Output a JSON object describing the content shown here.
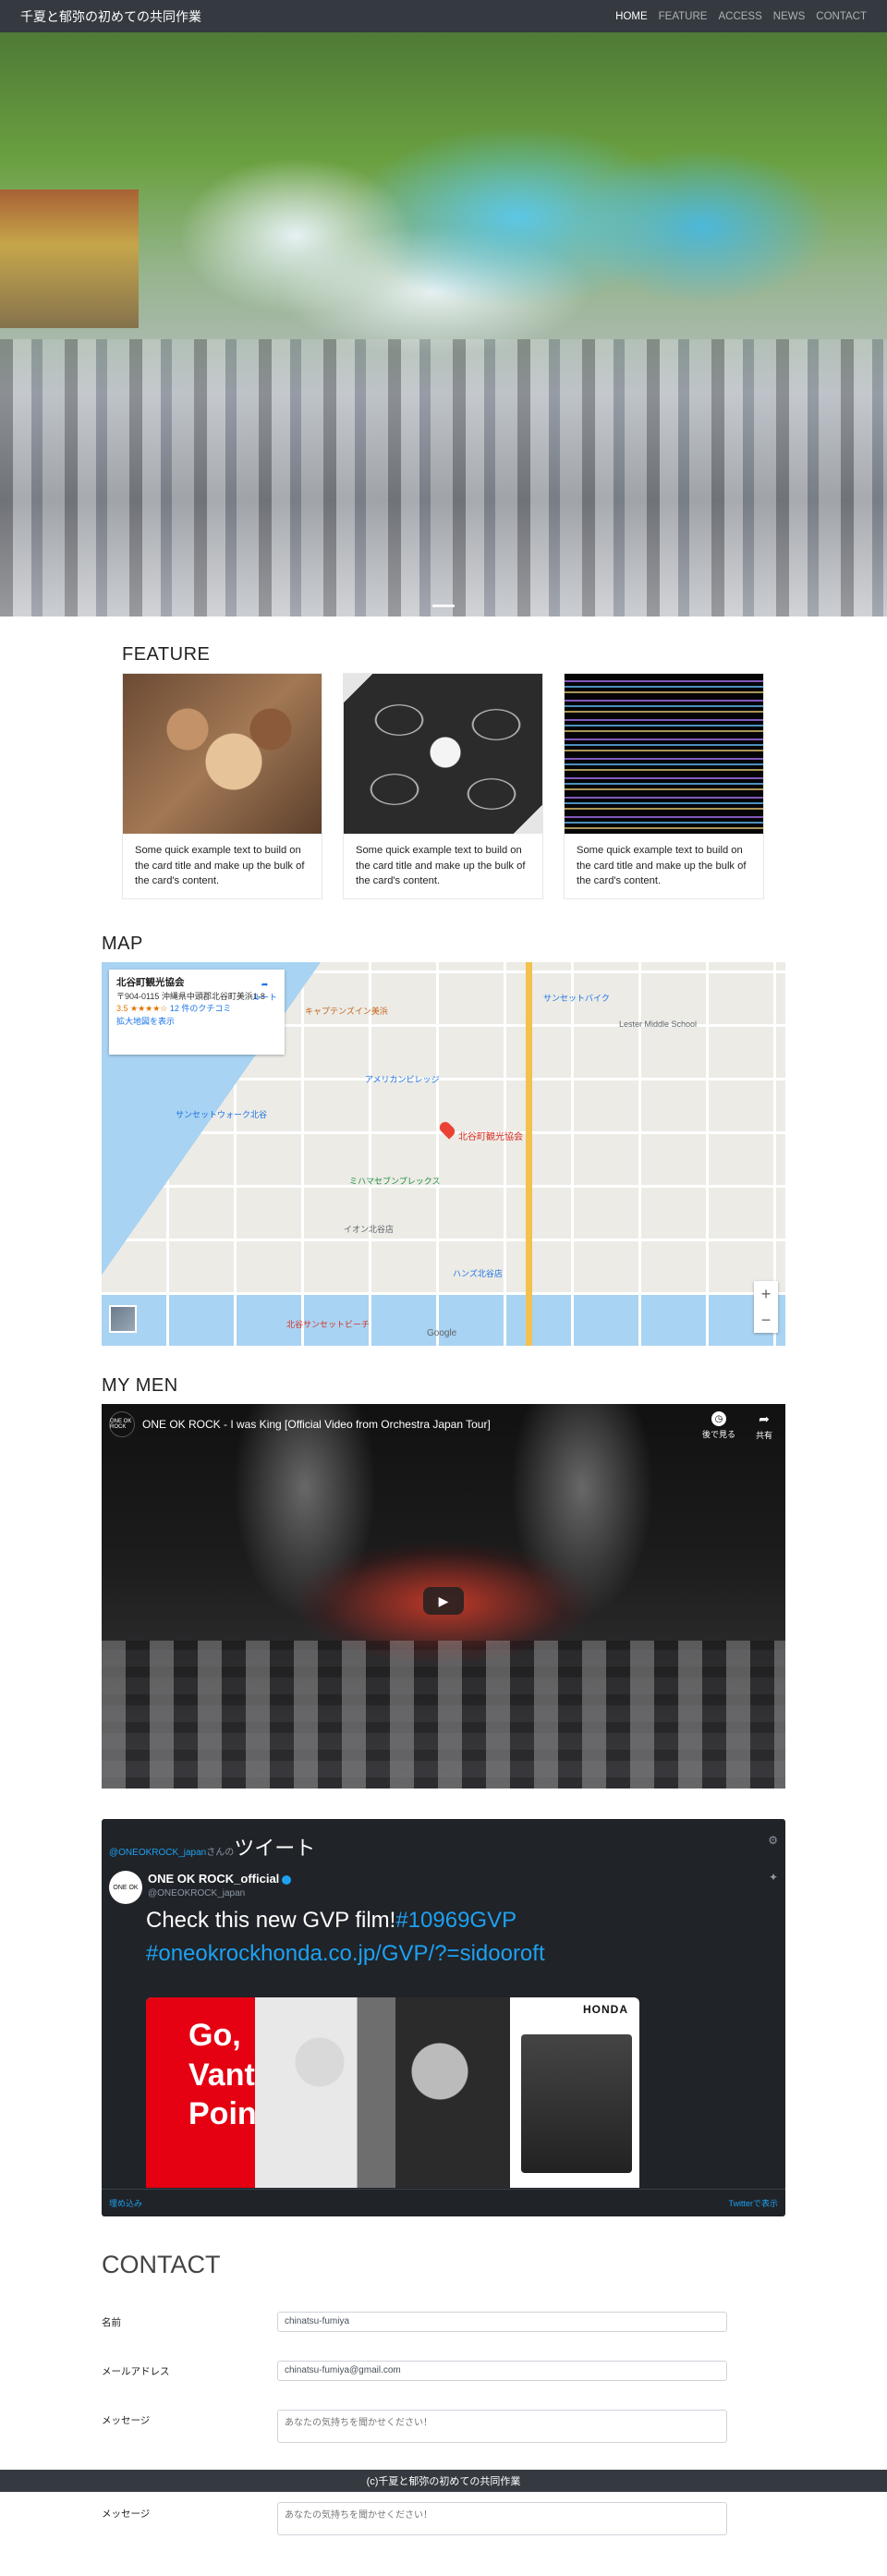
{
  "navbar": {
    "brand": "千夏と郁弥の初めての共同作業",
    "links": [
      "HOME",
      "FEATURE",
      "ACCESS",
      "NEWS",
      "CONTACT"
    ],
    "active_index": 0
  },
  "feature": {
    "heading": "FEATURE",
    "cards": [
      {
        "text": "Some quick example text to build on the card title and make up the bulk of the card's content."
      },
      {
        "text": "Some quick example text to build on the card title and make up the bulk of the card's content."
      },
      {
        "text": "Some quick example text to build on the card title and make up the bulk of the card's content."
      }
    ]
  },
  "map": {
    "heading": "MAP",
    "place_name": "北谷町観光協会",
    "address": "〒904-0115 沖縄県中頭郡北谷町美浜1-8",
    "rating": "3.5 ★★★★☆",
    "reviews": "12 件のクチコミ",
    "larger_map_link": "拡大地図を表示",
    "directions": "ルート",
    "pin_label": "北谷町観光協会",
    "labels": [
      "サンセットバイク",
      "キャプテンズイン美浜",
      "アメリカンビレッジ",
      "サンセットウォーク北谷",
      "ミハマセブンプレックス",
      "イオン北谷店",
      "北谷サンセットビーチ",
      "ハンズ北谷店",
      "Lester Middle School"
    ],
    "google": "Google",
    "zoom_in": "+",
    "zoom_out": "−"
  },
  "men": {
    "heading": "MY MEN",
    "channel": "ONE OK ROCK",
    "video_title": "ONE OK ROCK - I was King [Official Video from Orchestra Japan Tour]",
    "watch_later": "後で見る",
    "share": "共有"
  },
  "twitter": {
    "header_user": "@ONEOKROCK_japan",
    "header_suffix": "さんの",
    "header_big": "ツイート",
    "name": "ONE OK ROCK_official",
    "handle": "@ONEOKROCK_japan",
    "text_plain": "Check this new GVP film!",
    "text_tags": "#10969GVP #oneokrockhonda.co.jp/GVP/?=sidooroft",
    "media_text": "Go, Vantage Point",
    "media_brand": "HONDA",
    "embed": "埋め込み",
    "view_on_twitter": "Twitterで表示"
  },
  "contact": {
    "heading": "CONTACT",
    "name_label": "名前",
    "name_value": "chinatsu-fumiya",
    "email_label": "メールアドレス",
    "email_value": "chinatsu-fumiya@gmail.com",
    "message_label": "メッセージ",
    "message_placeholder": "あなたの気持ちを聞かせください！"
  },
  "footer": {
    "text": "(c)千夏と郁弥の初めての共同作業"
  }
}
